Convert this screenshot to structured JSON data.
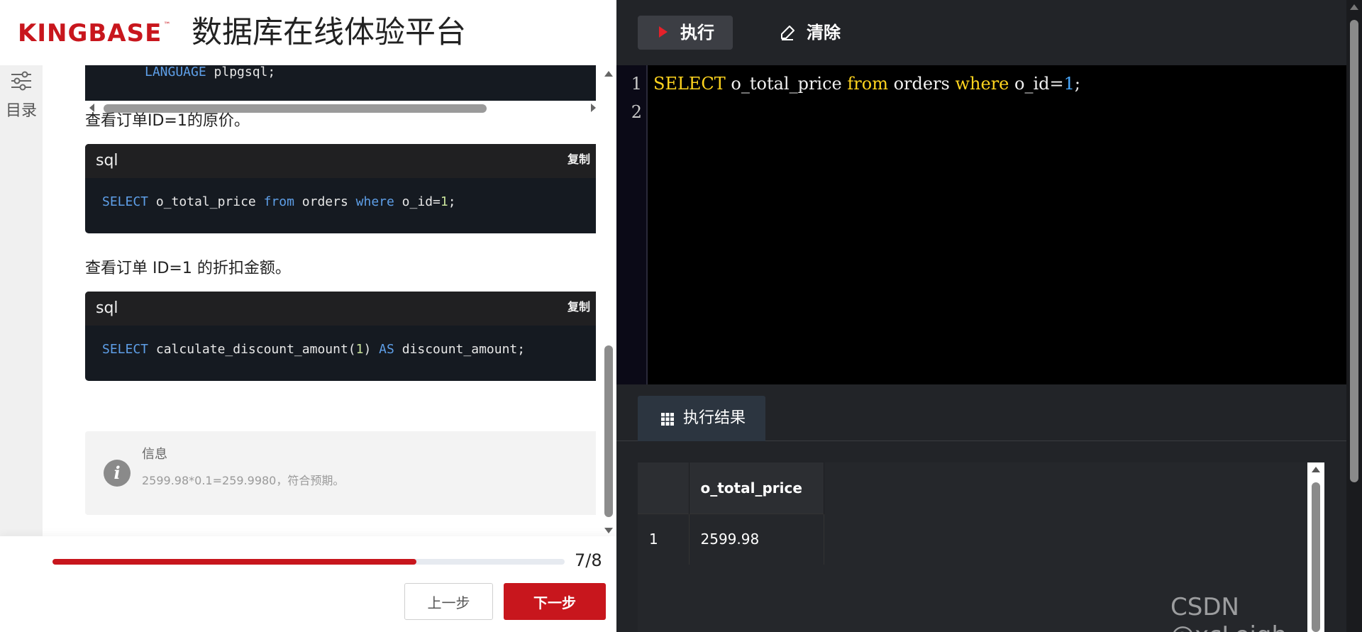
{
  "header": {
    "logo_text": "KINGBASE",
    "logo_tm": "™",
    "platform_title": "数据库在线体验平台"
  },
  "toc": {
    "label": "目录"
  },
  "content": {
    "top_code_line": {
      "keyword": "LANGUAGE",
      "rest": " plpgsql;"
    },
    "para1": "查看订单ID=1的原价。",
    "block1": {
      "lang": "sql",
      "copy": "复制",
      "tokens": {
        "t1": "SELECT",
        "t2": " o_total_price ",
        "t3": "from",
        "t4": " orders ",
        "t5": "where",
        "t6": " o_id=",
        "t7": "1",
        "t8": ";"
      }
    },
    "para2": "查看订单 ID=1 的折扣金额。",
    "block2": {
      "lang": "sql",
      "copy": "复制",
      "tokens": {
        "t1": "SELECT",
        "t2": " calculate_discount_amount(",
        "t3": "1",
        "t4": ") ",
        "t5": "AS",
        "t6": " discount_amount;"
      }
    },
    "info": {
      "icon": "i",
      "title": "信息",
      "text": "2599.98*0.1=259.9980，符合预期。"
    }
  },
  "footer": {
    "progress_value": 0.71,
    "progress_text": "7/8",
    "prev_label": "上一步",
    "next_label": "下一步"
  },
  "editor": {
    "run_label": "执行",
    "clear_label": "清除",
    "line_numbers": [
      "1",
      "2"
    ],
    "line1": {
      "t1": "SELECT",
      "t2": " o_total_price ",
      "t3": "from",
      "t4": " orders ",
      "t5": "where",
      "t6": " o_id=",
      "t7": "1",
      "t8": ";"
    }
  },
  "results": {
    "tab_label": "执行结果",
    "columns": [
      "",
      "o_total_price"
    ],
    "rows": [
      [
        "1",
        "2599.98"
      ]
    ]
  },
  "watermark": "CSDN @xcLeigh",
  "colors": {
    "brand_red": "#c8161d",
    "editor_bg": "#000000",
    "panel_bg": "#222428",
    "keyword_yellow": "#ffd41e",
    "keyword_blue": "#5e9fe8"
  }
}
